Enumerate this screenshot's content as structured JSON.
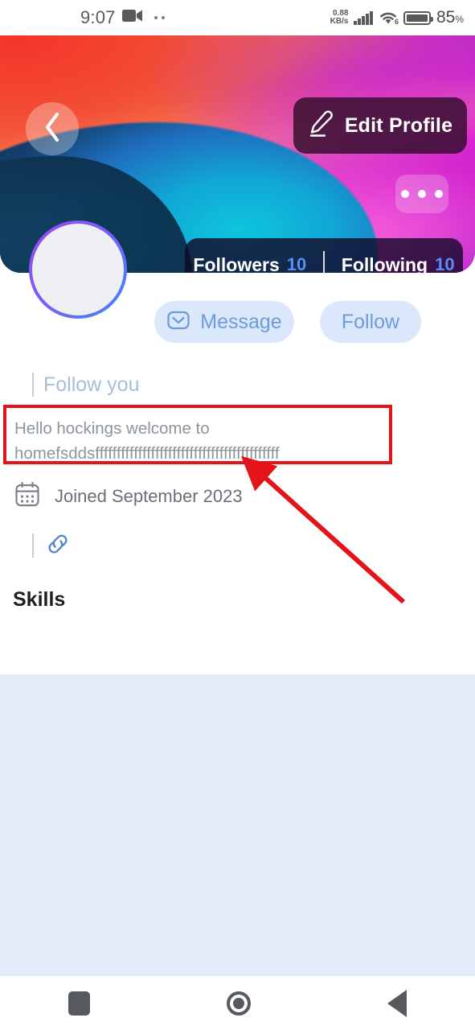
{
  "statusbar": {
    "time": "9:07",
    "video_icon": "video-camera-icon",
    "network_speed": "0.88",
    "network_unit": "KB/s",
    "wifi_gen": "6",
    "battery_percent": "85",
    "battery_percent_symbol": "%"
  },
  "banner": {
    "back_icon": "chevron-left-icon",
    "edit_button_label": "Edit Profile",
    "edit_icon": "pencil-icon",
    "more_icon": "more-horizontal-icon",
    "stats": {
      "followers_label": "Followers",
      "followers_count": "10",
      "following_label": "Following",
      "following_count": "10"
    },
    "colors": {
      "accent_red": "#f13a2e",
      "accent_magenta": "#d916d6",
      "accent_teal": "#0ec5dd",
      "accent_blue": "#1f6fbe"
    }
  },
  "profile": {
    "avatar_ring_start": "#9b4bf0",
    "avatar_ring_end": "#3d8bf2",
    "actions": {
      "message_label": "Message",
      "message_icon": "envelope-icon",
      "follow_label": "Follow"
    },
    "follow_you_label": "Follow you",
    "bio": "Hello hockings welcome to homefsddsfffffffffffffffffffffffffffffffffffffffffff",
    "joined_label": "Joined September 2023",
    "joined_icon": "calendar-icon",
    "link_icon": "link-chain-icon",
    "skills_heading": "Skills"
  },
  "annotation": {
    "highlight_color": "#e3151a",
    "arrow_color": "#e3151a"
  },
  "navbar": {
    "recents_icon": "square-icon",
    "home_icon": "circle-icon",
    "back_icon": "triangle-left-icon"
  }
}
